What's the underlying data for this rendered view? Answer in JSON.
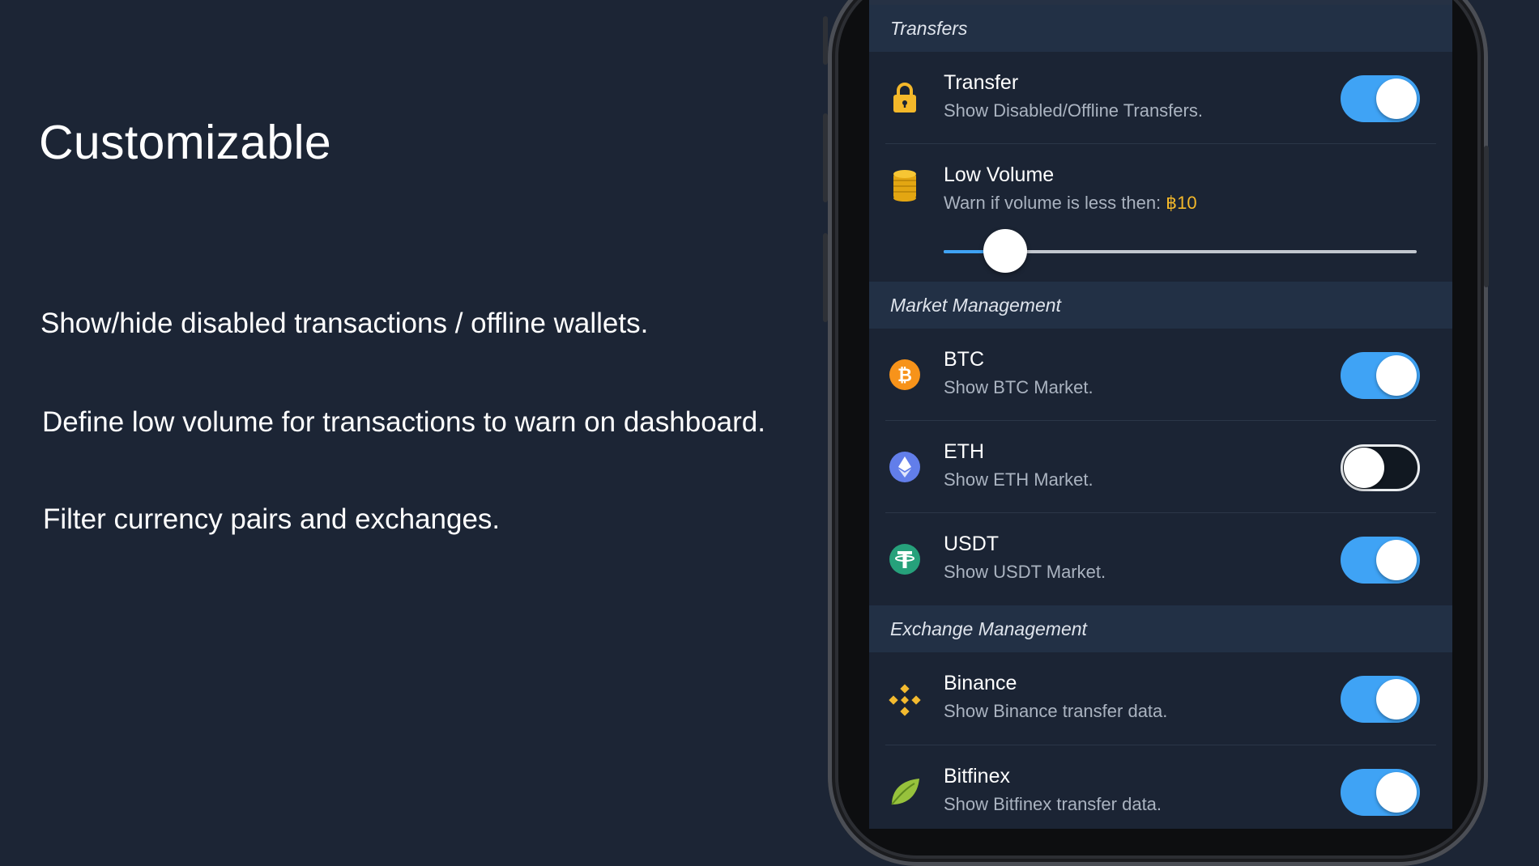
{
  "headline": "Customizable",
  "features": [
    "Show/hide disabled transactions / offline wallets.",
    "Define low volume for transactions to warn on dashboard.",
    "Filter currency pairs and exchanges."
  ],
  "colors": {
    "background": "#1c2535",
    "toggle_on": "#3fa3f5",
    "accent_gold": "#f4b82a"
  },
  "settings": {
    "transfers": {
      "section": "Transfers",
      "transfer": {
        "title": "Transfer",
        "subtitle": "Show Disabled/Offline Transfers.",
        "enabled": true,
        "icon": "lock-icon"
      },
      "low_volume": {
        "title": "Low Volume",
        "subtitle": "Warn if volume is less then:",
        "value": "฿10",
        "slider_fraction": 0.13,
        "icon": "coin-stack-icon"
      }
    },
    "markets": {
      "section": "Market Management",
      "items": [
        {
          "title": "BTC",
          "subtitle": "Show BTC Market.",
          "enabled": true,
          "icon": "bitcoin-icon"
        },
        {
          "title": "ETH",
          "subtitle": "Show ETH Market.",
          "enabled": false,
          "icon": "ethereum-icon"
        },
        {
          "title": "USDT",
          "subtitle": "Show USDT Market.",
          "enabled": true,
          "icon": "tether-icon"
        }
      ]
    },
    "exchanges": {
      "section": "Exchange Management",
      "items": [
        {
          "title": "Binance",
          "subtitle": "Show Binance transfer data.",
          "enabled": true,
          "icon": "binance-icon"
        },
        {
          "title": "Bitfinex",
          "subtitle": "Show Bitfinex transfer data.",
          "enabled": true,
          "icon": "bitfinex-leaf-icon"
        }
      ]
    }
  }
}
